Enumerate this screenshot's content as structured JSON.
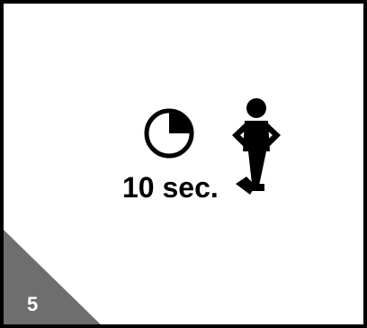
{
  "timer": {
    "label": "10 sec.",
    "icon": "self-timer-clock-icon",
    "elapsed_fraction": 0.25
  },
  "subject": {
    "icon": "standing-person-icon"
  },
  "step": {
    "number": "5",
    "corner_color": "#6e6e6e"
  },
  "colors": {
    "foreground": "#000000",
    "background": "#ffffff"
  }
}
